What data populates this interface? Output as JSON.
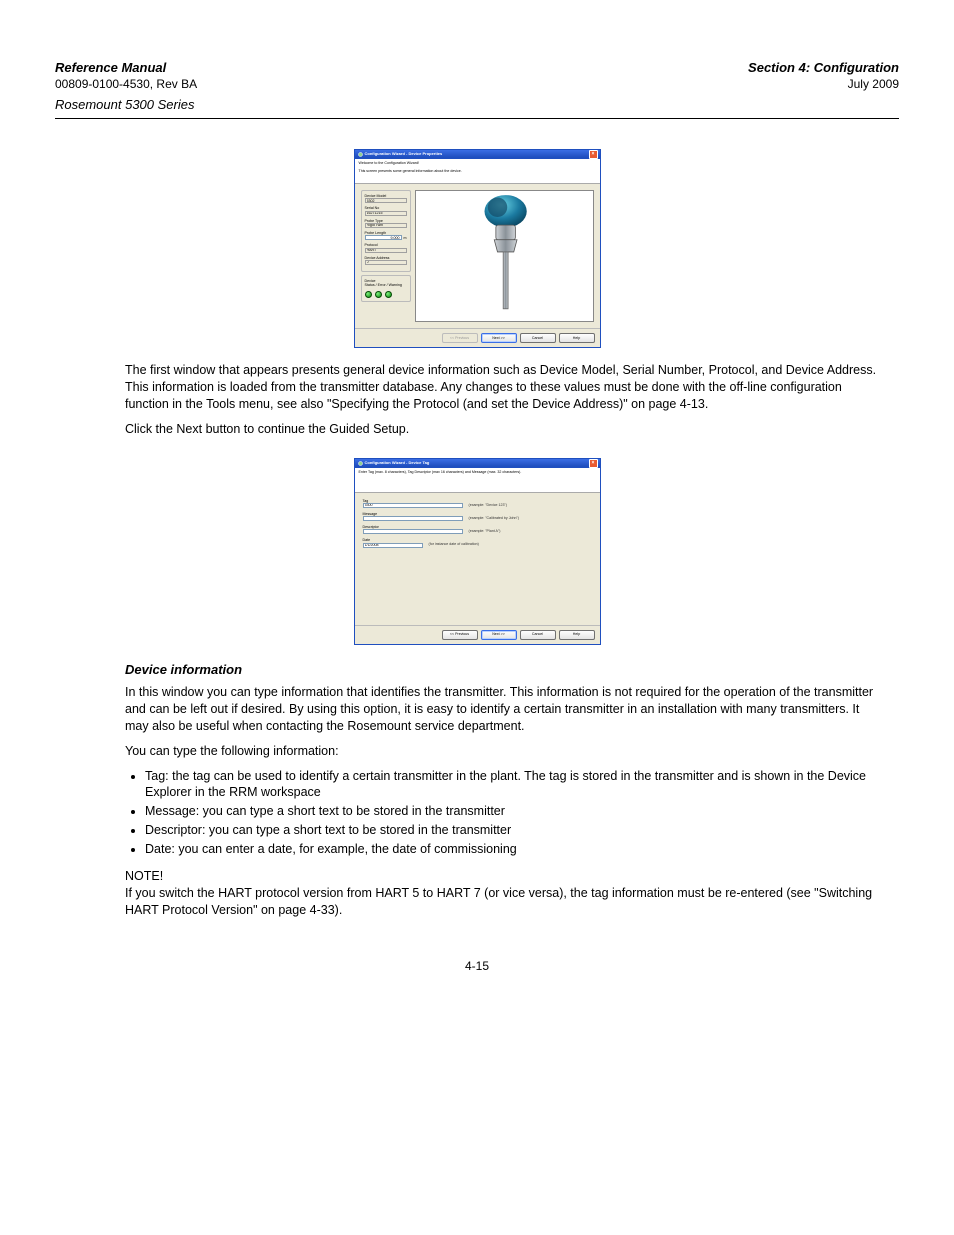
{
  "page": {
    "header_left": "Reference Manual",
    "doc_ref": "00809-0100-4530, Rev BA",
    "section_right": "Section 4: Configuration",
    "date_right": "July 2009",
    "product": "Rosemount 5300 Series",
    "page_number": "4-15"
  },
  "dialog1": {
    "title": "Configuration Wizard - Device Properties",
    "instr_title": "Welcome to the Configuration Wizard!",
    "instr_sub": "This screen presents some general information about the device.",
    "fields": {
      "device_model_label": "Device Model",
      "device_model_value": "5302",
      "serial_no_label": "Serial No",
      "serial_no_value": "16271215",
      "probe_type_label": "Probe Type",
      "probe_type_value": "Rigid Twin",
      "probe_length_label": "Probe Length",
      "probe_length_value": "9.000",
      "probe_length_unit": "m",
      "protocol_label": "Protocol",
      "protocol_value": "HART",
      "device_address_label": "Device Address",
      "device_address_value": "0"
    },
    "status": {
      "device_label": "Device",
      "labels": "Status / Error / Warning"
    },
    "buttons": {
      "previous": "<< Previous",
      "next": "Next >>",
      "cancel": "Cancel",
      "help": "Help"
    }
  },
  "text1": {
    "para1": "The first window that appears presents general device information such as Device Model, Serial Number, Protocol, and Device Address. This information is loaded from the transmitter database. Any changes to these values must be done with the off-line configuration function in the Tools menu, see also \"Specifying the Protocol (and set the Device Address)\" on page 4-13.",
    "para2": "Click the Next button to continue the Guided Setup."
  },
  "dialog2": {
    "title": "Configuration Wizard - Device Tag",
    "instr": "Enter Tag (max. 8 characters), Tag Descriptor (max 16 characters) and Message (max. 32 characters).",
    "fields": {
      "tag_label": "Tag",
      "tag_value": "5300",
      "tag_hint": "(example: \"Device 123\")",
      "message_label": "Message",
      "message_value": "",
      "message_hint": "(example: \"Calibrated by John\")",
      "descriptor_label": "Descriptor",
      "descriptor_value": "",
      "descriptor_hint": "(example: \"Plant A\")",
      "date_label": "Date",
      "date_value": "1/1/2008",
      "date_hint": "(for instance date of calibration)"
    },
    "buttons": {
      "previous": "<< Previous",
      "next": "Next >>",
      "cancel": "Cancel",
      "help": "Help"
    }
  },
  "text2": {
    "heading": "Device information",
    "para1": "In this window you can type information that identifies the transmitter. This information is not required for the operation of the transmitter and can be left out if desired. By using this option, it is easy to identify a certain transmitter in an installation with many transmitters. It may also be useful when contacting the Rosemount service department.",
    "bullet_intro": "You can type the following information:",
    "bullets": [
      "Tag: the tag can be used to identify a certain transmitter in the plant. The tag is stored in the transmitter and is shown in the Device Explorer in the RRM workspace",
      "Message: you can type a short text to be stored in the transmitter",
      "Descriptor: you can type a short text to be stored in the transmitter",
      "Date: you can enter a date, for example, the date of commissioning"
    ],
    "note_label": "NOTE!",
    "note_text": "If you switch the HART protocol version from HART 5 to HART 7 (or vice versa), the tag information must be re-entered (see \"Switching HART Protocol Version\" on page 4-33)."
  }
}
